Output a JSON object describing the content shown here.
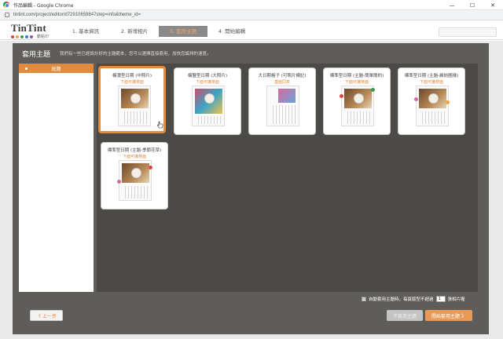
{
  "window": {
    "title": "作品編輯 - Google Chrome",
    "controls": [
      "—",
      "☐",
      "✕"
    ],
    "url": "tintint.com/project/editor/d72910659847step=info&theme_id="
  },
  "app": {
    "logo_text": "TinTint",
    "logo_tagline": "動點印",
    "logo_dot_colors": [
      "#e0463d",
      "#f2a33a",
      "#3a9c4c",
      "#3b7bd4",
      "#8b55c4"
    ],
    "steps": [
      {
        "label": "1. 基本資訊",
        "active": false
      },
      {
        "label": "2. 新增相片",
        "active": false
      },
      {
        "label": "3. 套用主題",
        "active": true
      },
      {
        "label": "4. 開始編輯",
        "active": false
      }
    ]
  },
  "panel": {
    "title": "套用主題",
    "description": "我們有一些已經設計好的主題範本，您可以選擇直接套用，加快您編排的速度。",
    "sidebar": {
      "items": [
        {
          "label": "底題",
          "selected": true
        }
      ]
    },
    "themes": [
      {
        "title": "橫濃型日期 (中照片)",
        "subtitle": "下面可攜帶面",
        "selected": true
      },
      {
        "title": "橫豎型日期 (大照片)",
        "subtitle": "下面可攜帶面",
        "selected": false
      },
      {
        "title": "大日期格子 (可照片標記)",
        "subtitle": "蓋面同意",
        "selected": false
      },
      {
        "title": "標準型日期 (主題-簡單簡約)",
        "subtitle": "下面可攜帶面",
        "selected": false
      },
      {
        "title": "標準型日期 (主題-繽紛圖樣)",
        "subtitle": "下面可攜帶面",
        "selected": false
      },
      {
        "title": "標準型日期 (主題-季節花草)",
        "subtitle": "下面可攜帶面",
        "selected": false
      }
    ],
    "auto_apply": {
      "checked": true,
      "check_mark": "☑",
      "label": "自動套用主題時，每頁版型不超過",
      "value": "1",
      "suffix": "張相片喔"
    }
  },
  "buttons": {
    "prev": "《 上一步",
    "skip": "不套用主題",
    "start": "開始套用主題 》"
  },
  "colors": {
    "accent": "#e08c3e",
    "panel": "#5f5d59",
    "content": "#4b4a47"
  }
}
